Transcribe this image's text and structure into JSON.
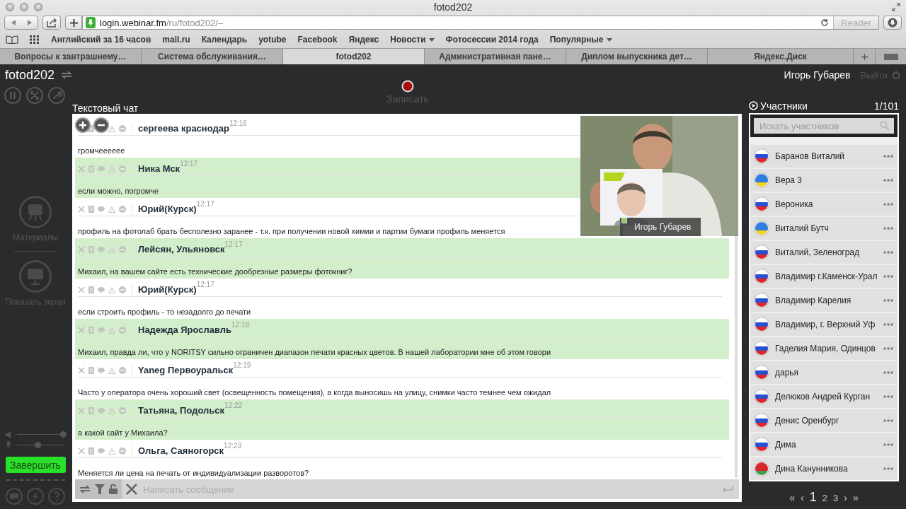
{
  "window": {
    "title": "fotod202"
  },
  "address_bar": {
    "host": "login.webinar.fm",
    "path": "/ru/fotod202/–",
    "reader": "Reader"
  },
  "bookmarks": [
    {
      "label": "Английский за 16 часов",
      "dropdown": false
    },
    {
      "label": "mail.ru",
      "dropdown": false
    },
    {
      "label": "Календарь",
      "dropdown": false
    },
    {
      "label": "yotube",
      "dropdown": false
    },
    {
      "label": "Facebook",
      "dropdown": false
    },
    {
      "label": "Яндекс",
      "dropdown": false
    },
    {
      "label": "Новости",
      "dropdown": true
    },
    {
      "label": "Фотосессии 2014 года",
      "dropdown": false
    },
    {
      "label": "Популярные",
      "dropdown": true
    }
  ],
  "tabs": [
    {
      "label": "Вопросы к завтрашнему…",
      "selected": false
    },
    {
      "label": "Система обслуживания…",
      "selected": false
    },
    {
      "label": "fotod202",
      "selected": true
    },
    {
      "label": "Административная пане…",
      "selected": false
    },
    {
      "label": "Диплом выпускника дет…",
      "selected": false
    },
    {
      "label": "Яндекс.Диск",
      "selected": false
    }
  ],
  "header": {
    "room": "fotod202",
    "record": "Записать",
    "user": "Игорь Губарев",
    "logout": "Выйти"
  },
  "sidebar": {
    "items": [
      {
        "label": "Материалы",
        "kind": "materials"
      },
      {
        "label": "Показать экран",
        "kind": "screen"
      }
    ],
    "speaker": {
      "level": 0.95
    },
    "microphone": {
      "level": 0.42
    },
    "finish": "Завершить"
  },
  "chat": {
    "title": "Текстовый чат",
    "messages": [
      {
        "author": "сергеева краснодар",
        "time": "12:16",
        "text": "громчееееее",
        "highlighted": false
      },
      {
        "author": "Ника Мск",
        "time": "12:17",
        "text": "если можно, погромче",
        "highlighted": true
      },
      {
        "author": "Юрий(Курск)",
        "time": "12:17",
        "text": "профиль на фотолаб брать бесполезно заранее - т.к. при получении новой химии и партии бумаги профиль меняется",
        "highlighted": false
      },
      {
        "author": "Лейсян, Ульяновск",
        "time": "12:17",
        "text": "Михаил, на вашем сайте есть технические дообрезные размеры фотокниг?",
        "highlighted": true
      },
      {
        "author": "Юрий(Курск)",
        "time": "12:17",
        "text": "если строить профиль - то незадолго до печати",
        "highlighted": false
      },
      {
        "author": "Надежда Ярославль",
        "time": "12:18",
        "text": "Михаил, правда ли, что у NORITSY сильно ограничен диапазон печати красных цветов. В нашей лаборатории мне об этом говори",
        "highlighted": true
      },
      {
        "author": "Yaneg Первоуральск",
        "time": "12:19",
        "text": "Часто у оператора очень хороший свет (освещенность помещения), а когда выносишь на улицу, снимки часто темнее чем ожидал",
        "highlighted": false
      },
      {
        "author": "Татьяна, Подольск",
        "time": "12:22",
        "text": "а какой сайт у Михаила?",
        "highlighted": true
      },
      {
        "author": "Ольга, Саяногорск",
        "time": "12:23",
        "text": "Меняется ли цена на печать от индивидуализации разворотов?",
        "highlighted": false
      }
    ],
    "input": {
      "placeholder": "Написать сообщение"
    },
    "video": {
      "kind": "picture",
      "caption": "Игорь Губарев"
    }
  },
  "participants": {
    "title": "Участники",
    "count": "1/101",
    "search": {
      "placeholder": "Искать участников"
    },
    "items": [
      {
        "name": "Баранов Виталий",
        "kind": "ru"
      },
      {
        "name": "Вера 3",
        "kind": "ua"
      },
      {
        "name": "Вероника",
        "kind": "ru"
      },
      {
        "name": "Виталий Бутч",
        "kind": "ua"
      },
      {
        "name": "Виталий, Зеленоград",
        "kind": "ru"
      },
      {
        "name": "Владимир г.Каменск-Урал",
        "kind": "ru"
      },
      {
        "name": "Владимир Карелия",
        "kind": "ru"
      },
      {
        "name": "Владимир, г. Верхний Уф",
        "kind": "ru"
      },
      {
        "name": "Гаделия Мария, Одинцов",
        "kind": "ru"
      },
      {
        "name": "дарья",
        "kind": "ru"
      },
      {
        "name": "Делюков Андрей Курган",
        "kind": "ru"
      },
      {
        "name": "Денис Оренбург",
        "kind": "ru"
      },
      {
        "name": "Дима",
        "kind": "ru"
      },
      {
        "name": "Дина Канунникова",
        "kind": "by"
      }
    ],
    "pagination": {
      "first": "«",
      "prev": "‹",
      "next": "›",
      "last": "»",
      "pages": [
        {
          "label": "1",
          "selected": true
        },
        {
          "label": "2",
          "selected": false
        },
        {
          "label": "3",
          "selected": false
        }
      ]
    }
  }
}
